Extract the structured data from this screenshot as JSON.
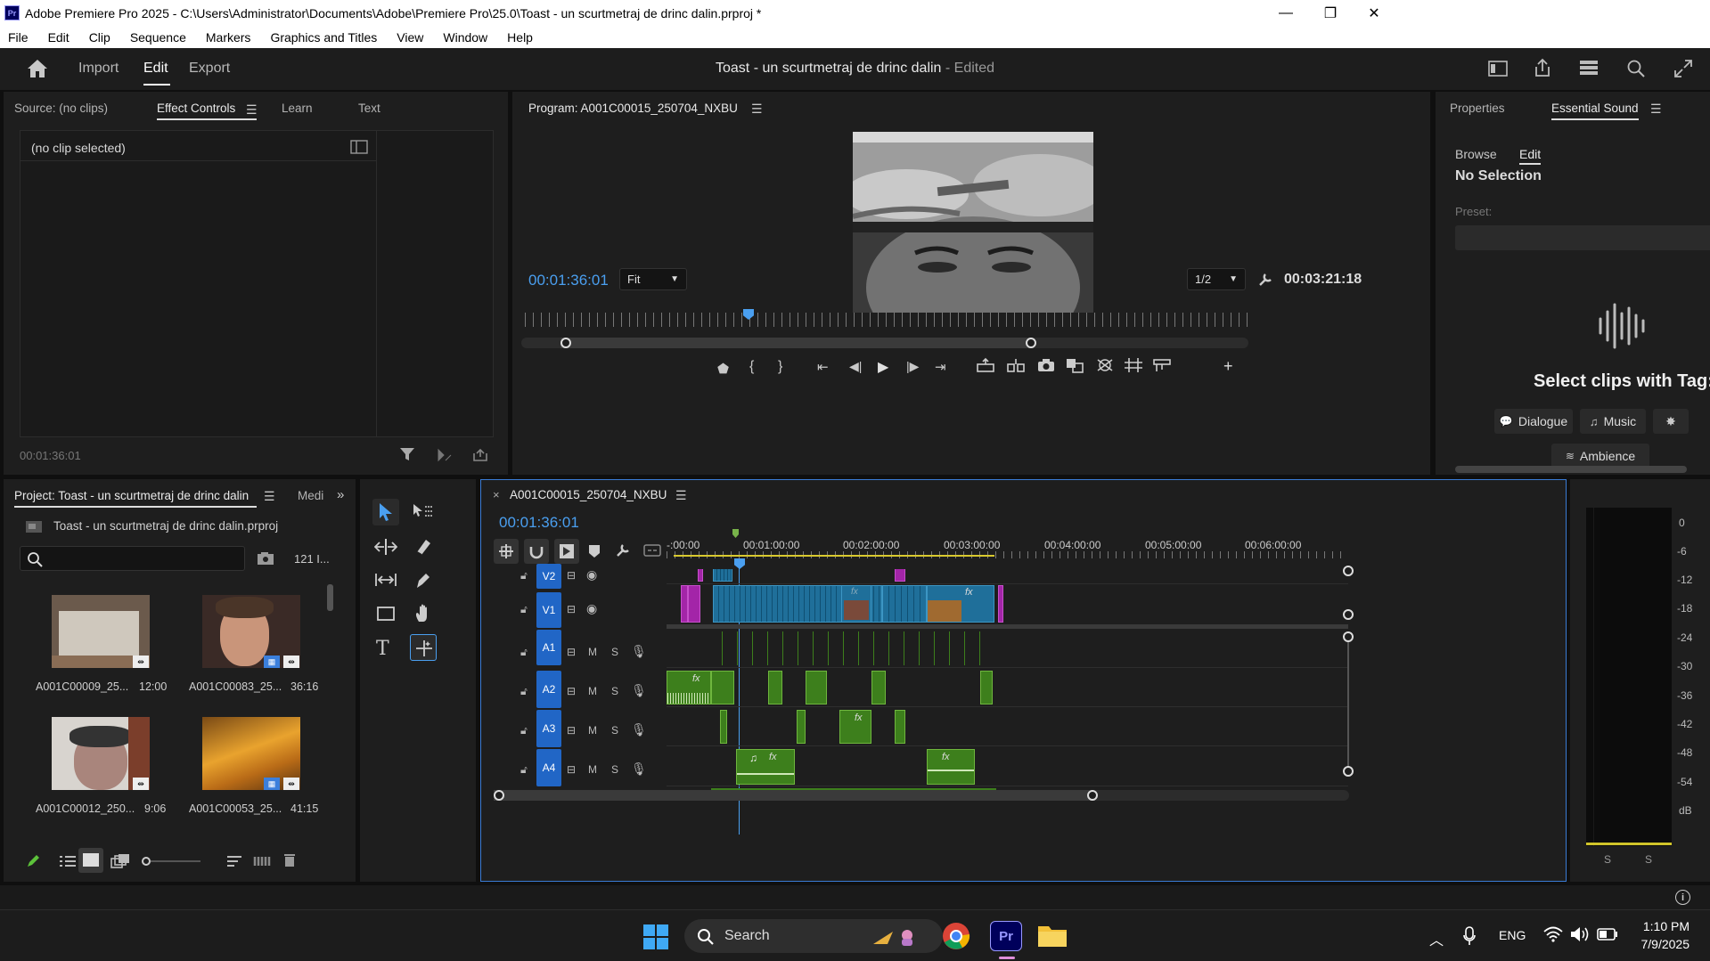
{
  "window": {
    "title": "Adobe Premiere Pro 2025 - C:\\Users\\Administrator\\Documents\\Adobe\\Premiere Pro\\25.0\\Toast - un scurtmetraj de drinc dalin.prproj *",
    "minimize": "—",
    "restore": "❐",
    "close": "✕"
  },
  "menu": [
    "File",
    "Edit",
    "Clip",
    "Sequence",
    "Markers",
    "Graphics and Titles",
    "View",
    "Window",
    "Help"
  ],
  "header": {
    "tabs": [
      "Import",
      "Edit",
      "Export"
    ],
    "active": "Edit",
    "project_title": "Toast - un scurtmetraj de drinc dalin",
    "edited": " - Edited"
  },
  "source_panel": {
    "tabs": [
      "Source: (no clips)",
      "Effect Controls",
      "Learn",
      "Text"
    ],
    "no_clip": "(no clip selected)",
    "timecode": "00:01:36:01"
  },
  "program": {
    "title": "Program: A001C00015_250704_NXBU",
    "current_tc": "00:01:36:01",
    "zoom": "Fit",
    "resolution": "1/2",
    "duration_tc": "00:03:21:18"
  },
  "essential_sound": {
    "tabs": [
      "Properties",
      "Essential Sound"
    ],
    "subtabs": [
      "Browse",
      "Edit"
    ],
    "no_selection": "No Selection",
    "preset_label": "Preset:",
    "select_msg": "Select clips with Tag:",
    "tags": [
      "Dialogue",
      "Music",
      "Ambience"
    ]
  },
  "project": {
    "title": "Project: Toast - un scurtmetraj de drinc dalin",
    "media_tab": "Medi",
    "file": "Toast - un scurtmetraj de drinc dalin.prproj",
    "count": "121 I...",
    "items": [
      {
        "name": "A001C00009_25...",
        "duration": "12:00"
      },
      {
        "name": "A001C00083_25...",
        "duration": "36:16"
      },
      {
        "name": "A001C00012_250...",
        "duration": "9:06"
      },
      {
        "name": "A001C00053_25...",
        "duration": "41:15"
      }
    ]
  },
  "timeline": {
    "sequence": "A001C00015_250704_NXBU",
    "close": "×",
    "timecode": "00:01:36:01",
    "ruler": [
      "-:00:00",
      "00:01:00:00",
      "00:02:00:00",
      "00:03:00:00",
      "00:04:00:00",
      "00:05:00:00",
      "00:06:00:00"
    ],
    "video_tracks": [
      "V2",
      "V1"
    ],
    "audio_tracks": [
      "A1",
      "A2",
      "A3",
      "A4"
    ],
    "m": "M",
    "s": "S"
  },
  "meter": {
    "scale": [
      "0",
      "-6",
      "-12",
      "-18",
      "-24",
      "-30",
      "-36",
      "-42",
      "-48",
      "-54",
      "dB"
    ],
    "solo": [
      "S",
      "S"
    ]
  },
  "taskbar": {
    "search": "Search",
    "lang": "ENG",
    "time": "1:10 PM",
    "date": "7/9/2025"
  },
  "colors": {
    "accent_blue": "#4a9ff0",
    "track_blue": "#2166c6",
    "clip_green": "#3d7f1c",
    "clip_teal": "#1f6f9a",
    "clip_purple": "#a325a8"
  }
}
